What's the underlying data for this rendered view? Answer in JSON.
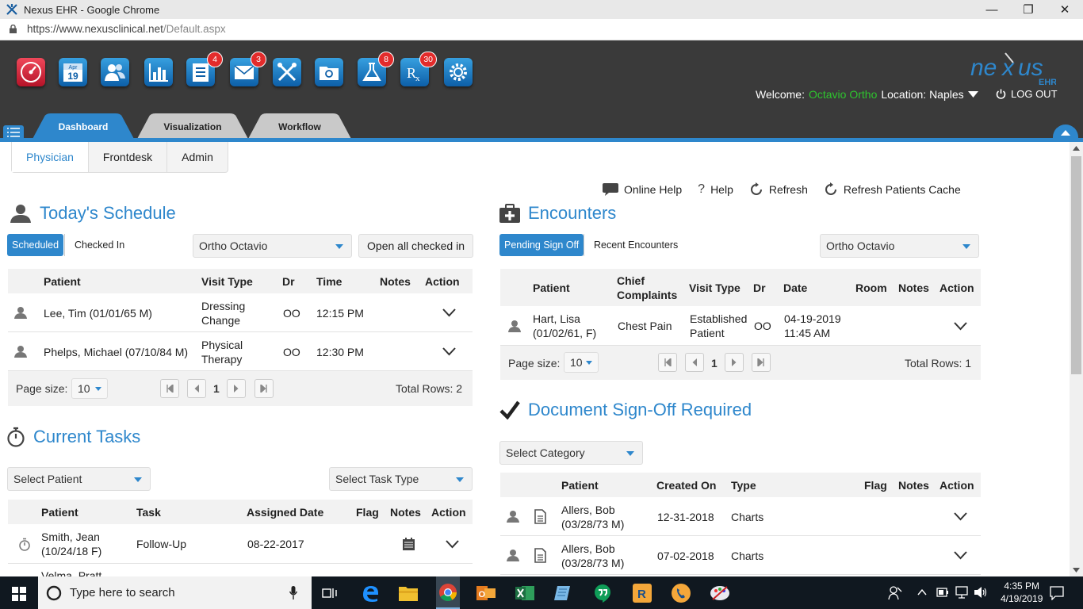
{
  "window": {
    "title": "Nexus EHR - Google Chrome",
    "url_host": "https://www.nexusclinical.net",
    "url_path": "/Default.aspx"
  },
  "toolbar": {
    "icons": [
      {
        "name": "dashboard-gauge-icon",
        "badge": ""
      },
      {
        "name": "calendar-icon",
        "badge": "",
        "month": "Apr",
        "day": "19"
      },
      {
        "name": "patients-icon",
        "badge": ""
      },
      {
        "name": "reports-chart-icon",
        "badge": ""
      },
      {
        "name": "tasks-list-icon",
        "badge": "4"
      },
      {
        "name": "messages-envelope-icon",
        "badge": "3"
      },
      {
        "name": "tools-icon",
        "badge": ""
      },
      {
        "name": "documents-folder-icon",
        "badge": ""
      },
      {
        "name": "lab-flask-icon",
        "badge": "8"
      },
      {
        "name": "rx-icon",
        "badge": "30"
      },
      {
        "name": "settings-gear-icon",
        "badge": ""
      }
    ]
  },
  "header": {
    "welcome_label": "Welcome:",
    "user_name": "Octavio Ortho",
    "location_label": "Location: Naples",
    "logout": "LOG OUT",
    "logo": "nexus EHR"
  },
  "tabs": {
    "dashboard": "Dashboard",
    "visualization": "Visualization",
    "workflow": "Workflow"
  },
  "subtabs": {
    "physician": "Physician",
    "frontdesk": "Frontdesk",
    "admin": "Admin"
  },
  "help": {
    "online_help": "Online Help",
    "help": "Help",
    "refresh": "Refresh",
    "refresh_cache": "Refresh Patients Cache"
  },
  "schedule": {
    "title": "Today's Schedule",
    "tab_scheduled": "Scheduled",
    "tab_checked_in": "Checked In",
    "provider": "Ortho Octavio",
    "open_checked_in": "Open all checked in",
    "columns": [
      "Patient",
      "Visit Type",
      "Dr",
      "Time",
      "Notes",
      "Action"
    ],
    "rows": [
      {
        "patient": "Lee, Tim (01/01/65 M)",
        "visit": "Dressing Change",
        "dr": "OO",
        "time": "12:15 PM"
      },
      {
        "patient": "Phelps, Michael (07/10/84 M)",
        "visit": "Physical Therapy",
        "dr": "OO",
        "time": "12:30 PM"
      }
    ],
    "page_size_label": "Page size:",
    "page_size": "10",
    "page": "1",
    "total": "Total Rows: 2"
  },
  "tasks": {
    "title": "Current Tasks",
    "select_patient": "Select Patient",
    "select_task_type": "Select Task Type",
    "columns": [
      "Patient",
      "Task",
      "Assigned Date",
      "Flag",
      "Notes",
      "Action"
    ],
    "rows": [
      {
        "patient": "Smith, Jean (10/24/18 F)",
        "task": "Follow-Up",
        "date": "08-22-2017"
      },
      {
        "patient": "Velma, Pratt",
        "task": "",
        "date": ""
      }
    ]
  },
  "encounters": {
    "title": "Encounters",
    "tab_pending": "Pending Sign Off",
    "tab_recent": "Recent Encounters",
    "provider": "Ortho Octavio",
    "columns": [
      "Patient",
      "Chief Complaints",
      "Visit Type",
      "Dr",
      "Date",
      "Room",
      "Notes",
      "Action"
    ],
    "rows": [
      {
        "patient": "Hart, Lisa (01/02/61, F)",
        "complaint": "Chest Pain",
        "visit": "Established Patient",
        "dr": "OO",
        "date": "04-19-2019 11:45 AM"
      }
    ],
    "page_size_label": "Page size:",
    "page_size": "10",
    "page": "1",
    "total": "Total Rows: 1"
  },
  "documents": {
    "title": "Document Sign-Off Required",
    "select_category": "Select Category",
    "columns": [
      "Patient",
      "Created On",
      "Type",
      "Flag",
      "Notes",
      "Action"
    ],
    "rows": [
      {
        "patient": "Allers, Bob (03/28/73 M)",
        "created": "12-31-2018",
        "type": "Charts"
      },
      {
        "patient": "Allers, Bob (03/28/73 M)",
        "created": "07-02-2018",
        "type": "Charts"
      }
    ]
  },
  "taskbar": {
    "search_placeholder": "Type here to search",
    "time": "4:35 PM",
    "date": "4/19/2019"
  },
  "colors": {
    "accent": "#2e87cc",
    "header_bg": "#3a3a3a",
    "user_green": "#2ec52e",
    "badge_red": "#e32b2b"
  }
}
